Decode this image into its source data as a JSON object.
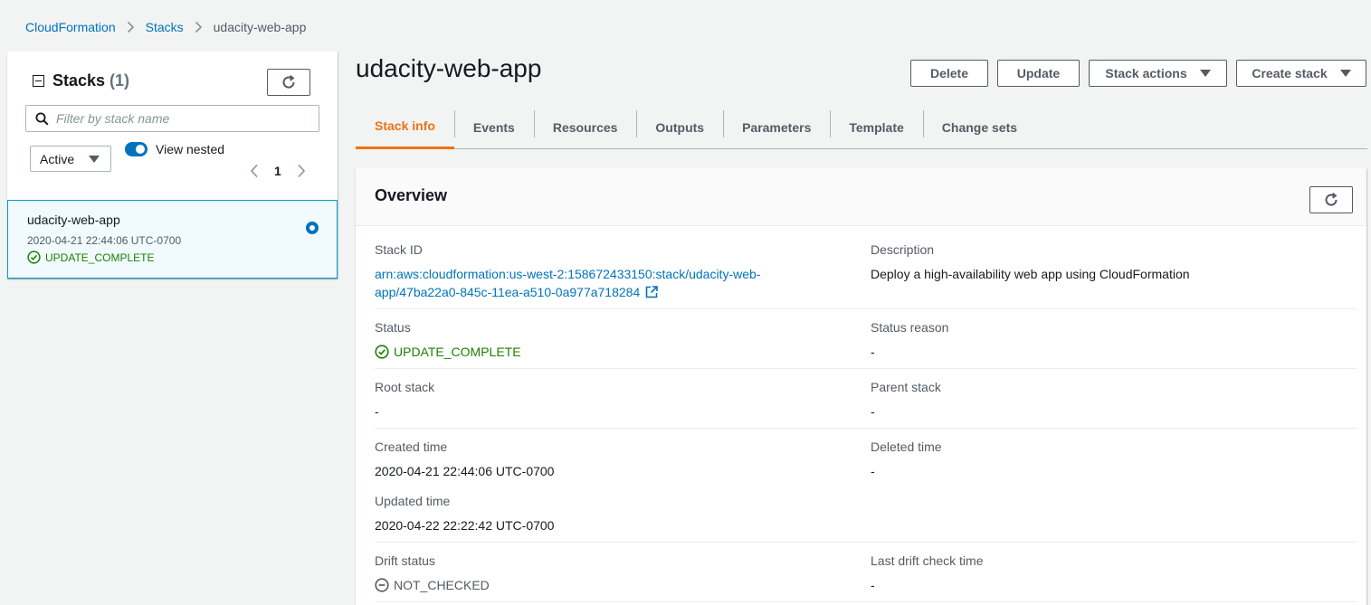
{
  "breadcrumb": {
    "root": "CloudFormation",
    "stacks": "Stacks",
    "current": "udacity-web-app"
  },
  "sidebar": {
    "title": "Stacks",
    "count": "(1)",
    "search_placeholder": "Filter by stack name",
    "filter_value": "Active",
    "view_nested_label": "View nested",
    "page": "1",
    "stack": {
      "name": "udacity-web-app",
      "created": "2020-04-21 22:44:06 UTC-0700",
      "status": "UPDATE_COMPLETE"
    }
  },
  "main": {
    "title": "udacity-web-app",
    "buttons": {
      "delete": "Delete",
      "update": "Update",
      "stack_actions": "Stack actions",
      "create_stack": "Create stack"
    },
    "tabs": [
      "Stack info",
      "Events",
      "Resources",
      "Outputs",
      "Parameters",
      "Template",
      "Change sets"
    ],
    "overview": {
      "title": "Overview",
      "stack_id_label": "Stack ID",
      "stack_id_line1": "arn:aws:cloudformation:us-west-2:158672433150:stack/udacity-web-",
      "stack_id_line2": "app/47ba22a0-845c-11ea-a510-0a977a718284",
      "description_label": "Description",
      "description": "Deploy a high-availability web app using CloudFormation",
      "status_label": "Status",
      "status": "UPDATE_COMPLETE",
      "status_reason_label": "Status reason",
      "status_reason": "-",
      "root_stack_label": "Root stack",
      "root_stack": "-",
      "parent_stack_label": "Parent stack",
      "parent_stack": "-",
      "created_time_label": "Created time",
      "created_time": "2020-04-21 22:44:06 UTC-0700",
      "deleted_time_label": "Deleted time",
      "deleted_time": "-",
      "updated_time_label": "Updated time",
      "updated_time": "2020-04-22 22:22:42 UTC-0700",
      "drift_status_label": "Drift status",
      "drift_status": "NOT_CHECKED",
      "last_drift_label": "Last drift check time",
      "last_drift": "-"
    }
  },
  "colors": {
    "link": "#0073bb",
    "success": "#1d8102",
    "active_tab": "#ec7211",
    "selected_border": "#00a1c9"
  }
}
